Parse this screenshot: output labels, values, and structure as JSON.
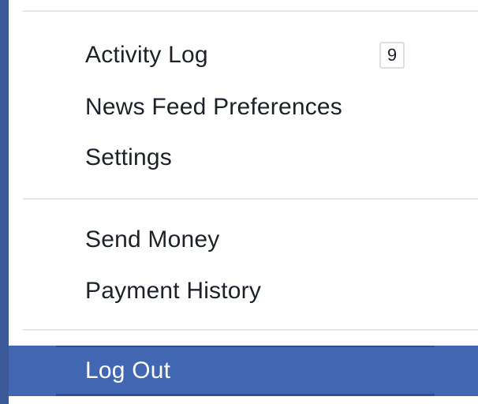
{
  "menu": {
    "groups": [
      {
        "items": [
          {
            "label": "Activity Log",
            "badge": "9"
          },
          {
            "label": "News Feed Preferences"
          },
          {
            "label": "Settings"
          }
        ]
      },
      {
        "items": [
          {
            "label": "Send Money"
          },
          {
            "label": "Payment History"
          }
        ]
      },
      {
        "items": [
          {
            "label": "Log Out",
            "highlighted": true
          }
        ]
      }
    ]
  },
  "colors": {
    "frame_background": "#3b5998",
    "menu_background": "#ffffff",
    "highlight": "#4267b2",
    "text": "#1d2129",
    "divider": "#e4e6eb"
  }
}
